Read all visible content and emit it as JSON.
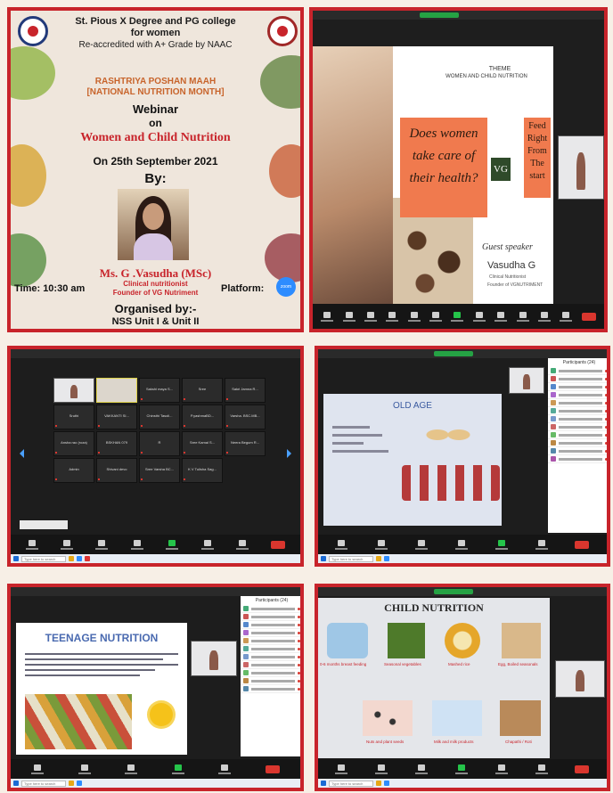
{
  "poster": {
    "college_line1": "St. Pious X Degree and PG college",
    "college_line2": "for women",
    "accreditation": "Re-accredited with A+ Grade by NAAC",
    "event_line1": "RASHTRIYA POSHAN MAAH",
    "event_line2": "[NATIONAL NUTRITION MONTH]",
    "webinar": "Webinar",
    "on": "on",
    "topic": "Women and Child Nutrition",
    "date": "On 25th September 2021",
    "by": "By:",
    "speaker": "Ms. G .Vasudha (MSc)",
    "speaker_role1": "Clinical nutritionist",
    "speaker_role2": "Founder of VG Nutriment",
    "time": "Time: 10:30 am",
    "platform": "Platform:",
    "zoom": "zoom",
    "organised_by": "Organised by:-",
    "organiser": "NSS Unit I & Unit II"
  },
  "slide_theme": {
    "theme_line1": "THEME",
    "theme_line2": "WOMEN AND CHILD NUTRITION",
    "question_line1": "Does women",
    "question_line2": "take care of",
    "question_line3": "their health?",
    "feed_line1": "Feed",
    "feed_line2": "Right",
    "feed_line3": "From",
    "feed_line4": "The",
    "feed_line5": "start",
    "logo": "VG",
    "guest_line1": "Guest speaker",
    "guest_name": "Vasudha G",
    "guest_role1": "Clinical Nutritionist",
    "guest_role2": "Founder of VGNUTRIMENT"
  },
  "gallery": {
    "tiles": [
      {
        "name": "Sakshi maya S...",
        "sub": ""
      },
      {
        "name": "Sree",
        "sub": ""
      },
      {
        "name": "Sakri Jamna R...",
        "sub": ""
      },
      {
        "name": "Sruthi",
        "sub": ""
      },
      {
        "name": "VAKKANTI SI...",
        "sub": ""
      },
      {
        "name": "Chinsthi Tasoli...",
        "sub": ""
      },
      {
        "name": "P.yashmaBD...",
        "sub": ""
      },
      {
        "name": "Varsha. BSC.MB...",
        "sub": ""
      },
      {
        "name": "Ansha rao (roza)",
        "sub": ""
      },
      {
        "name": "BSKHAN 079",
        "sub": ""
      },
      {
        "name": "R",
        "sub": ""
      },
      {
        "name": "Sree Kamal S...",
        "sub": ""
      },
      {
        "name": "Neera Begum R...",
        "sub": ""
      },
      {
        "name": "Admin",
        "sub": ""
      },
      {
        "name": "Shivani devo",
        "sub": ""
      },
      {
        "name": "Sree Varsha BC...",
        "sub": ""
      },
      {
        "name": "K V Tulisha Sag...",
        "sub": ""
      }
    ]
  },
  "slide_old_age": {
    "title": "OLD AGE"
  },
  "slide_teenage": {
    "title": "TEENAGE NUTRITION"
  },
  "slide_child": {
    "title": "CHILD NUTRITION",
    "item1": "0-6 months breast feeding",
    "item2": "Seasonal vegetables",
    "item3": "Mashed rice",
    "item4": "Egg, Boiled seasonals",
    "item5": "Nuts and plant seeds",
    "item6": "Milk and milk products",
    "item7": "Chapathi / Roti"
  },
  "participants_header": "Participants (24)",
  "taskbar_search": "Type here to search",
  "colors": {
    "frame": "#c8242b",
    "zoom_dark": "#1d1d1d",
    "green": "#25a244",
    "end": "#d9362e",
    "slide_orange": "#f07a4e"
  }
}
